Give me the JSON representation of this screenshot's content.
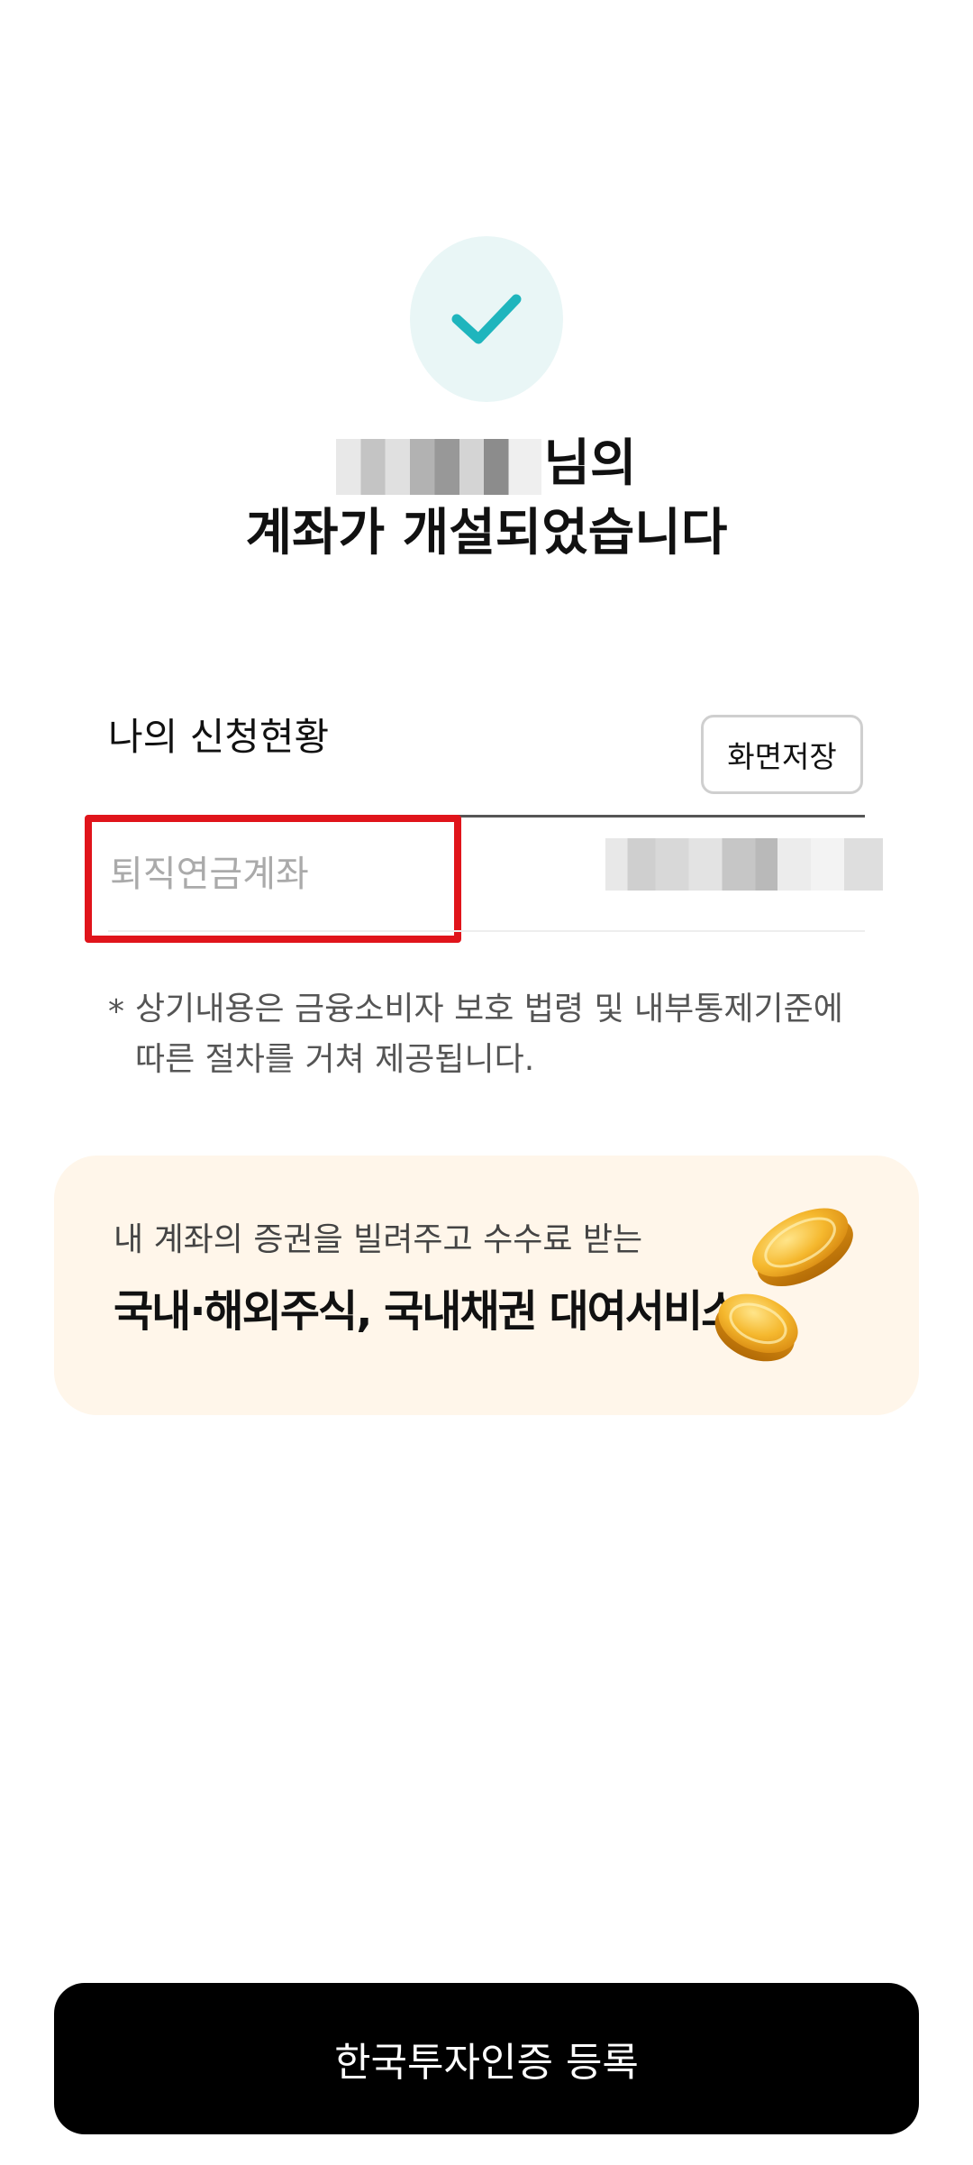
{
  "header": {
    "title_suffix": "님의",
    "title_line2": "계좌가 개설되었습니다"
  },
  "status": {
    "label": "나의 신청현황",
    "save_button_label": "화면저장",
    "account_type": "퇴직연금계좌"
  },
  "disclaimer": {
    "mark": "*",
    "text": "상기내용은 금융소비자 보호 법령 및 내부통제기준에 따른 절차를 거쳐 제공됩니다."
  },
  "promo": {
    "subtitle": "내 계좌의 증권을 빌려주고 수수료 받는",
    "title": "국내·해외주식, 국내채권 대여서비스"
  },
  "footer": {
    "button_label": "한국투자인증 등록"
  },
  "colors": {
    "accent": "#1fb5bd",
    "highlight": "#e0141b",
    "banner_bg": "#fff6ea",
    "button_bg": "#000000"
  },
  "icons": {
    "check": "check-icon",
    "coins": "coins-icon"
  }
}
